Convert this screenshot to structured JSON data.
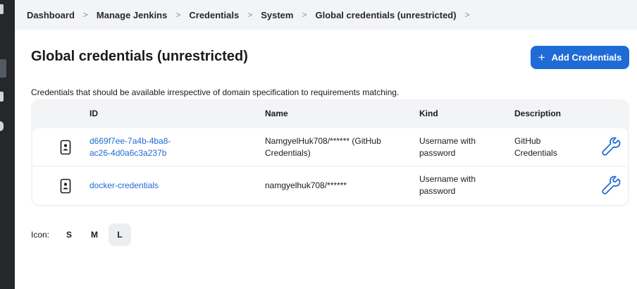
{
  "breadcrumb": {
    "items": [
      "Dashboard",
      "Manage Jenkins",
      "Credentials",
      "System",
      "Global credentials (unrestricted)"
    ],
    "separator": ">"
  },
  "page": {
    "title": "Global credentials (unrestricted)",
    "description": "Credentials that should be available irrespective of domain specification to requirements matching."
  },
  "add_button": {
    "label": "Add Credentials",
    "icon": "+"
  },
  "table": {
    "headers": {
      "id": "ID",
      "name": "Name",
      "kind": "Kind",
      "description": "Description"
    },
    "rows": [
      {
        "id_line1": "d669f7ee-7a4b-4ba8-",
        "id_line2": "ac26-4d0a6c3a237b",
        "name_line1": "NamgyelHuk708/****** (GitHub",
        "name_line2": "Credentials)",
        "kind_line1": "Username with",
        "kind_line2": "password",
        "desc_line1": "GitHub",
        "desc_line2": "Credentials"
      },
      {
        "id_line1": "docker-credentials",
        "name_line1": "namgyelhuk708/******",
        "kind_line1": "Username with",
        "kind_line2": "password",
        "desc_line1": ""
      }
    ]
  },
  "icon_size": {
    "label": "Icon:",
    "options": [
      "S",
      "M",
      "L"
    ],
    "selected": "L"
  },
  "colors": {
    "accent": "#1f6bd6",
    "breadcrumb_bg": "#f3f4f6",
    "table_bg": "#f3f4f6",
    "left_strip": "#25272b"
  }
}
